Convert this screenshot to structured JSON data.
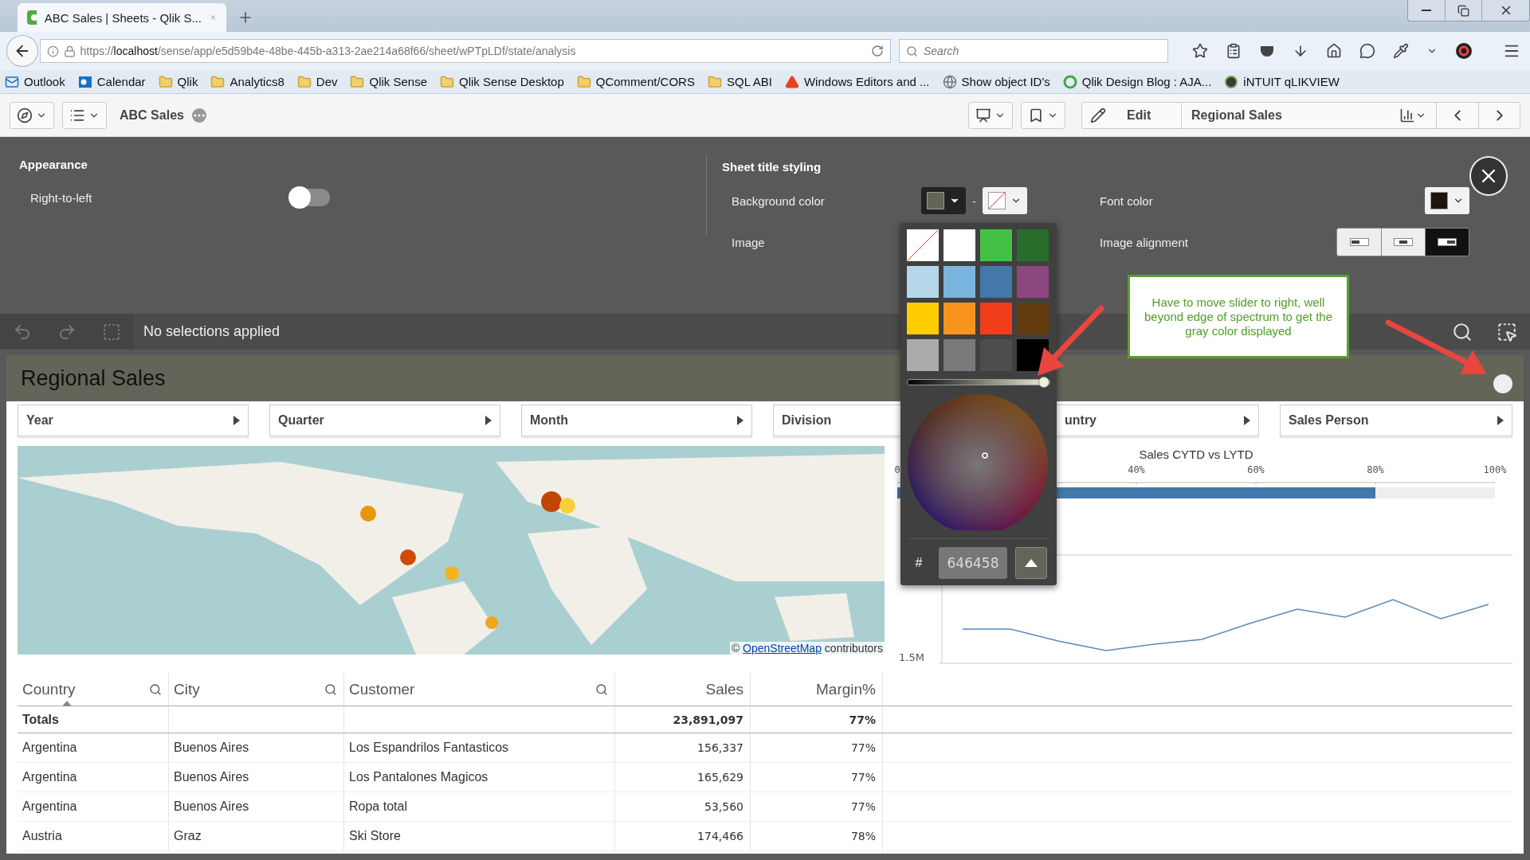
{
  "browser": {
    "tab": {
      "title": "ABC Sales | Sheets - Qlik S..."
    },
    "url": "https://**localhost**/sense/app/e5d59b4e-48be-445b-a313-2ae214a68f66/sheet/wPTpLDf/state/analysis",
    "search": {
      "placeholder": "Search"
    },
    "bookmarks": [
      {
        "kind": "mail",
        "label": "Outlook"
      },
      {
        "kind": "outlook",
        "label": "Calendar"
      },
      {
        "kind": "folder",
        "label": "Qlik"
      },
      {
        "kind": "folder",
        "label": "Analytics8"
      },
      {
        "kind": "folder",
        "label": "Dev"
      },
      {
        "kind": "folder",
        "label": "Qlik Sense"
      },
      {
        "kind": "folder",
        "label": "Qlik Sense Desktop"
      },
      {
        "kind": "folder",
        "label": "QComment/CORS"
      },
      {
        "kind": "folder",
        "label": "SQL ABI"
      },
      {
        "kind": "triangle",
        "label": "Windows Editors and ..."
      },
      {
        "kind": "globe",
        "label": "Show object ID's"
      },
      {
        "kind": "qlik",
        "label": "Qlik Design Blog : AJA..."
      },
      {
        "kind": "qlikdark",
        "label": "iNTUIT qLIKVIEW"
      }
    ]
  },
  "toolbar": {
    "app_title": "ABC Sales",
    "edit": "Edit",
    "sheet_title": "Regional Sales"
  },
  "settings": {
    "appearance": {
      "heading": "Appearance",
      "right_to_left": {
        "label": "Right-to-left",
        "on": false
      }
    },
    "sheet_title_styling": {
      "heading": "Sheet title styling",
      "background_color": {
        "label": "Background color",
        "color": "#646458",
        "separator": "-"
      },
      "font_color": {
        "label": "Font color",
        "color": "#1c150d"
      },
      "image": {
        "label": "Image"
      },
      "image_alignment": {
        "label": "Image alignment",
        "options": [
          {
            "kind": "left",
            "selected": false
          },
          {
            "kind": "center",
            "selected": false
          },
          {
            "kind": "right",
            "selected": true
          }
        ]
      }
    }
  },
  "color_picker": {
    "swatches": [
      {
        "kind": "none"
      },
      {
        "color": "#ffffff"
      },
      {
        "color": "#44c145"
      },
      {
        "color": "#276e2b"
      },
      {
        "color": "#b4d7ea"
      },
      {
        "color": "#7ab5dd"
      },
      {
        "color": "#4477aa"
      },
      {
        "color": "#8d477f"
      },
      {
        "color": "#ffcc00"
      },
      {
        "color": "#f7941d"
      },
      {
        "color": "#f23d1c"
      },
      {
        "color": "#633c0f"
      },
      {
        "color": "#aaaaaa"
      },
      {
        "color": "#7a7a7a"
      },
      {
        "color": "#4d4d4d"
      },
      {
        "color": "#000000"
      }
    ],
    "brightness": {
      "level": 1
    },
    "hash": "#",
    "hex": "646458"
  },
  "annotation": {
    "text": "Have to move slider to right, well beyond edge of spectrum to get the gray color displayed"
  },
  "selections": {
    "text": "No selections applied"
  },
  "sheet": {
    "title": "Regional Sales",
    "filters": [
      {
        "label": "Year",
        "kind": "full"
      },
      {
        "label": "Quarter",
        "kind": "full"
      },
      {
        "label": "Month",
        "kind": "full"
      },
      {
        "label": "Division",
        "kind": "right_hidden"
      },
      {
        "label": "untry",
        "kind": "left_hidden"
      },
      {
        "label": "Sales Person",
        "kind": "full"
      }
    ],
    "map": {
      "attribution": {
        "prefix": "©",
        "link": "OpenStreetMap",
        "suffix": "contributors"
      }
    },
    "gauge": {
      "title": "Sales CYTD vs LYTD",
      "level": 0.8,
      "ticks": [
        "0",
        "40%",
        "60%",
        "80%",
        "100%"
      ]
    },
    "line_chart": {
      "y_label": "1.5M"
    },
    "table": {
      "columns": [
        {
          "label": "Country",
          "kind": "text",
          "searchable": true,
          "sorted": true
        },
        {
          "label": "City",
          "kind": "text",
          "searchable": true,
          "sorted": false
        },
        {
          "label": "Customer",
          "kind": "text",
          "searchable": true,
          "sorted": false
        },
        {
          "label": "Sales",
          "kind": "number",
          "searchable": false,
          "sorted": false
        },
        {
          "label": "Margin%",
          "kind": "number",
          "searchable": false,
          "sorted": false
        }
      ],
      "totals": {
        "label": "Totals",
        "values": [
          "23,891,097",
          "77%"
        ]
      },
      "rows": [
        [
          "Argentina",
          "Buenos Aires",
          "Los Espandrilos Fantasticos",
          "156,337",
          "77%"
        ],
        [
          "Argentina",
          "Buenos Aires",
          "Los Pantalones Magicos",
          "165,629",
          "77%"
        ],
        [
          "Argentina",
          "Buenos Aires",
          "Ropa total",
          "53,560",
          "77%"
        ],
        [
          "Austria",
          "Graz",
          "Ski Store",
          "174,466",
          "78%"
        ]
      ]
    }
  }
}
